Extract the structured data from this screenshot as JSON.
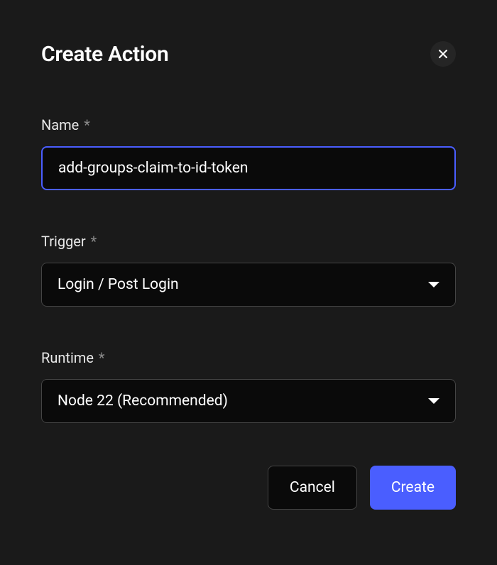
{
  "modal": {
    "title": "Create Action"
  },
  "fields": {
    "name": {
      "label": "Name",
      "value": "add-groups-claim-to-id-token"
    },
    "trigger": {
      "label": "Trigger",
      "value": "Login / Post Login"
    },
    "runtime": {
      "label": "Runtime",
      "value": "Node 22 (Recommended)"
    }
  },
  "buttons": {
    "cancel": "Cancel",
    "create": "Create"
  }
}
